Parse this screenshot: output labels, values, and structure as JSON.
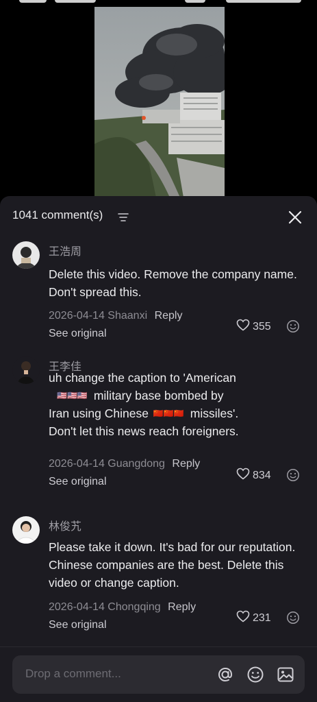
{
  "comment_count_label": "1041 comment(s)",
  "comments": [
    {
      "username": "王浩周",
      "text": "Delete this video. Remove the company name. Don't spread this.",
      "date": "2026-04-14",
      "location": "Shaanxi",
      "reply_label": "Reply",
      "see_original_label": "See original",
      "likes": "355"
    },
    {
      "username": "王李佳",
      "text_lines": [
        "uh change the caption to 'American",
        "military  base bombed by",
        "Iran using Chinese",
        "missiles'.",
        "Don't let this news reach foreigners."
      ],
      "us_flags": "🇺🇸🇺🇸🇺🇸",
      "cn_flags": "🇨🇳🇨🇳🇨🇳",
      "date": "2026-04-14",
      "location": "Guangdong",
      "reply_label": "Reply",
      "see_original_label": "See original",
      "likes": "834"
    },
    {
      "username": "林俊艽",
      "text": "Please take it down. It's bad for our reputation. Chinese companies are the best. Delete this video or change caption.",
      "date": "2026-04-14",
      "location": "Chongqing",
      "reply_label": "Reply",
      "see_original_label": "See original",
      "likes": "231"
    }
  ],
  "input": {
    "placeholder": "Drop a comment..."
  },
  "icons": [
    "filter-icon",
    "close-icon",
    "heart-icon",
    "smiley-icon",
    "at-icon",
    "emoji-icon",
    "image-icon"
  ],
  "colors": {
    "sheet_bg": "#1c1b21",
    "input_bg": "#2c2b31",
    "muted_text": "#8e8d94"
  }
}
